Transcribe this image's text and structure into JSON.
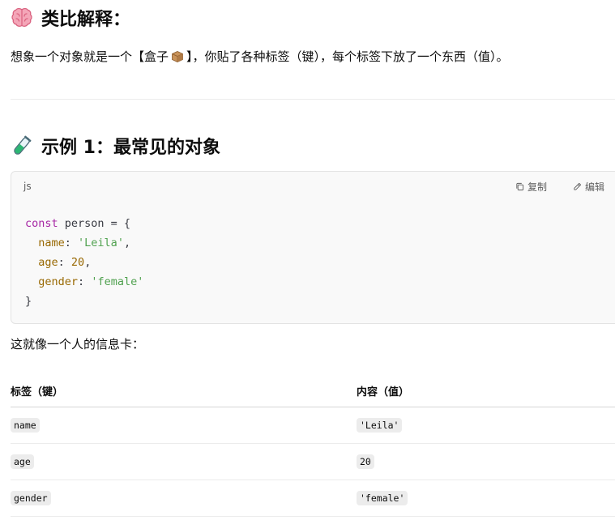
{
  "analogy": {
    "heading": "类比解释：",
    "text_before": "想象一个对象就是一个【盒子",
    "text_after": "】，你贴了各种标签（键），每个标签下放了一个东西（值）。",
    "heading_icon": "brain-icon",
    "box_icon": "package-box-icon"
  },
  "example": {
    "heading": "示例 1：最常见的对象",
    "heading_icon": "test-tube-icon"
  },
  "code": {
    "lang": "js",
    "copy_label": "复制",
    "edit_label": "编辑",
    "lines": {
      "l1_kw": "const",
      "l1_rest": " person = {",
      "l2_prop": "name",
      "l2_str": "'Leila'",
      "l3_prop": "age",
      "l3_num": "20",
      "l4_prop": "gender",
      "l4_str": "'female'",
      "l5": "}"
    }
  },
  "info_text": "这就像一个人的信息卡：",
  "table": {
    "headers": [
      "标签（键）",
      "内容（值）"
    ],
    "rows": [
      [
        "name",
        "'Leila'"
      ],
      [
        "age",
        "20"
      ],
      [
        "gender",
        "'female'"
      ]
    ]
  }
}
